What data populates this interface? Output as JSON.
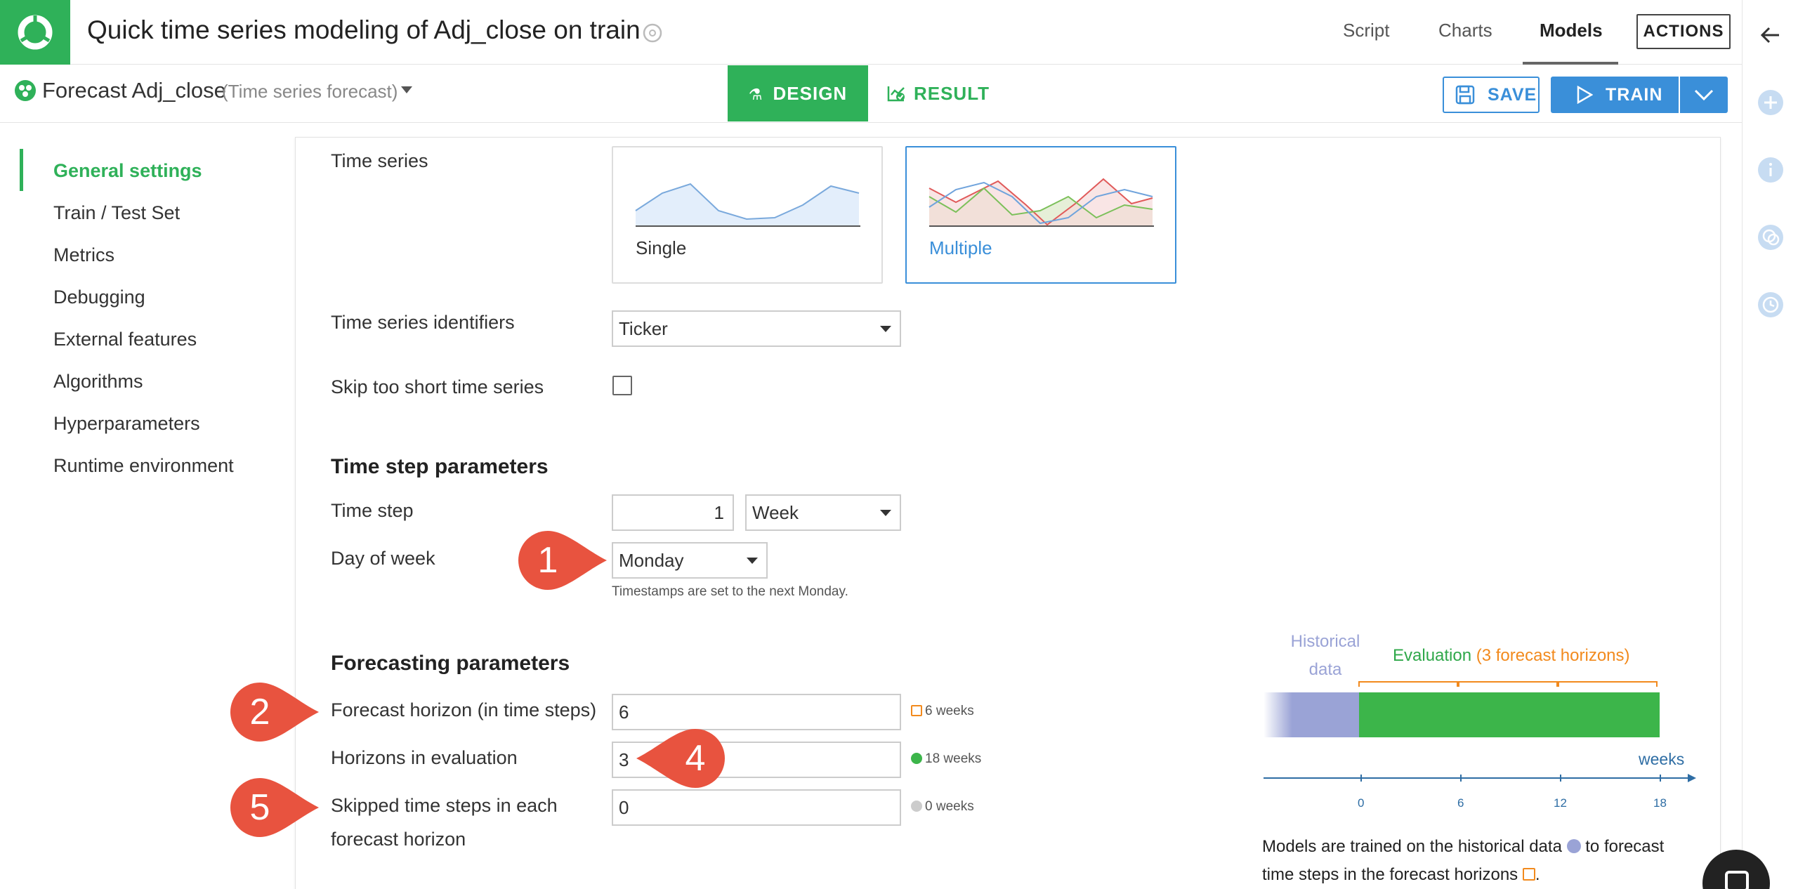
{
  "header": {
    "title": "Quick time series modeling of Adj_close on train",
    "tabs": [
      "Script",
      "Charts",
      "Models"
    ],
    "actions_label": "ACTIONS"
  },
  "subheader": {
    "model_name": "Forecast Adj_close",
    "model_type": "(Time series forecast)",
    "design_label": "DESIGN",
    "result_label": "RESULT",
    "save_label": "SAVE",
    "train_label": "TRAIN"
  },
  "sidebar": {
    "items": [
      {
        "label": "General settings",
        "active": true
      },
      {
        "label": "Train / Test Set"
      },
      {
        "label": "Metrics"
      },
      {
        "label": "Debugging"
      },
      {
        "label": "External features"
      },
      {
        "label": "Algorithms"
      },
      {
        "label": "Hyperparameters"
      },
      {
        "label": "Runtime environment"
      }
    ]
  },
  "form": {
    "time_series_label": "Time series",
    "cards": [
      {
        "label": "Single",
        "selected": false
      },
      {
        "label": "Multiple",
        "selected": true
      }
    ],
    "identifiers_label": "Time series identifiers",
    "identifiers_value": "Ticker",
    "skip_label": "Skip too short time series",
    "skip_checked": false,
    "time_step_section": "Time step parameters",
    "time_step_label": "Time step",
    "time_step_value": "1",
    "time_step_unit": "Week",
    "day_of_week_label": "Day of week",
    "day_of_week_value": "Monday",
    "day_of_week_hint": "Timestamps are set to the next Monday.",
    "forecasting_section": "Forecasting parameters",
    "horizon_label": "Forecast horizon (in time steps)",
    "horizon_value": "6",
    "horizon_unit": "6 weeks",
    "evaluation_label": "Horizons in evaluation",
    "evaluation_value": "3",
    "evaluation_unit": "18 weeks",
    "skipped_label_line1": "Skipped time steps in each",
    "skipped_label_line2": "forecast horizon",
    "skipped_value": "0",
    "skipped_unit": "0 weeks"
  },
  "diagram": {
    "historical_line1": "Historical",
    "historical_line2": "data",
    "evaluation_label": "Evaluation ",
    "evaluation_suffix": "(3 forecast horizons)",
    "axis_unit": "weeks",
    "ticks": [
      "0",
      "6",
      "12",
      "18"
    ],
    "description_part1": "Models are trained on the historical data",
    "description_part2": "to forecast",
    "description_part3": "time steps in the forecast horizons",
    "colors": {
      "historical": "#9aa3d6",
      "evaluation": "#3cb54a",
      "horizon": "#f28a1d",
      "axis": "#2e6da4"
    }
  },
  "callouts": [
    "1",
    "2",
    "4",
    "5"
  ],
  "colors": {
    "brand_green": "#2fb159",
    "accent_blue": "#3a8fd9",
    "callout_red": "#e8533f"
  }
}
